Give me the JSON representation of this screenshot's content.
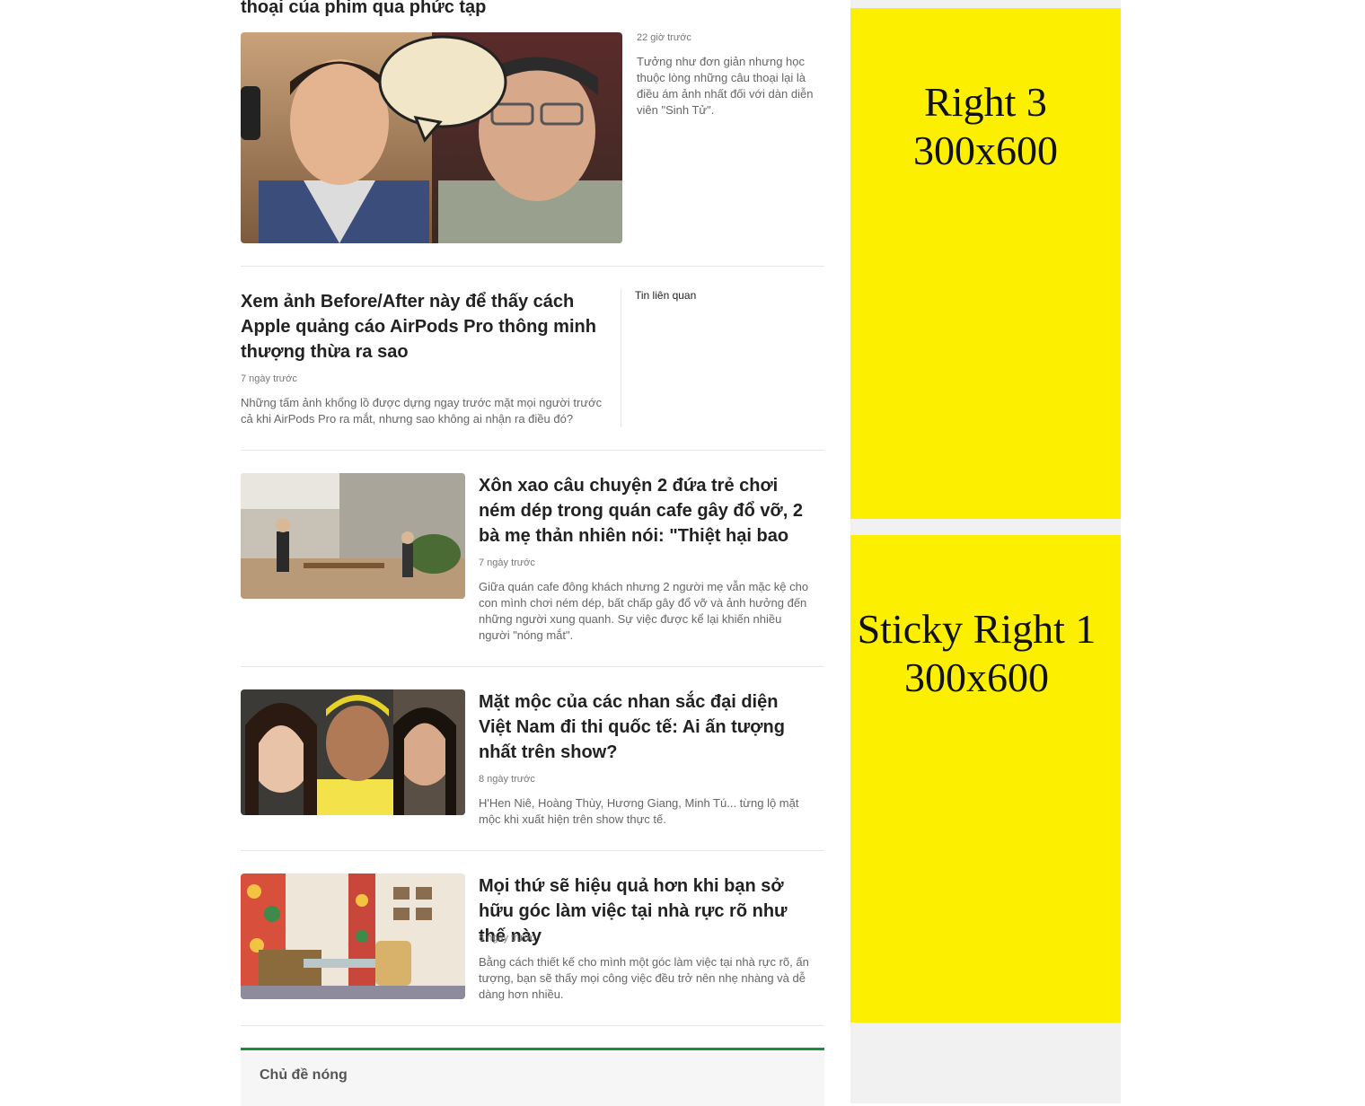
{
  "top_article": {
    "title_partial": "thoại của phim qua phức tạp",
    "time": "22 giờ trước",
    "description": "Tưởng như đơn giản nhưng học thuộc lòng những câu thoại lại là điều ám ảnh nhất đối với dàn diễn viên \"Sinh Tử\"."
  },
  "article_2": {
    "title": "Xem ảnh Before/After này để thấy cách Apple quảng cáo AirPods Pro thông minh thượng thừa ra sao",
    "time": "7 ngày trước",
    "description": "Những tấm ảnh khổng lồ được dựng ngay trước mặt mọi người trước cả khi AirPods Pro ra mắt, nhưng sao không ai nhận ra điều đó?",
    "related_label": "Tin liên quan"
  },
  "articles": [
    {
      "title": "Xôn xao câu chuyện 2 đứa trẻ chơi ném dép trong quán cafe gây đổ vỡ, 2 bà mẹ thản nhiên nói: \"Thiệt hại bao",
      "time": "7 ngày trước",
      "description": "Giữa quán cafe đông khách nhưng 2 người mẹ vẫn mặc kệ cho con mình chơi ném dép, bất chấp gây đổ vỡ và ảnh hưởng đến những người xung quanh. Sự việc được kể lại khiến nhiều người \"nóng mắt\"."
    },
    {
      "title": "Mặt mộc của các nhan sắc đại diện Việt Nam đi thi quốc tế: Ai ấn tượng nhất trên show?",
      "time": "8 ngày trước",
      "description": "H'Hen Niê, Hoàng Thùy, Hương Giang, Minh Tú... từng lộ mặt mộc khi xuất hiện trên show thực tế."
    },
    {
      "title": "Mọi thứ sẽ hiệu quả hơn khi bạn sở hữu góc làm việc tại nhà rực rõ như thế này",
      "time": "8 ngày trước",
      "description": "Bằng cách thiết kế cho mình một góc làm việc tại nhà rực rõ, ấn tượng, bạn sẽ thấy mọi công việc đều trở nên nhẹ nhàng và dễ dàng hơn nhiều."
    }
  ],
  "hot_topics": {
    "title": "Chủ đề nóng"
  },
  "ads": {
    "right3": {
      "line1": "Right 3",
      "line2": "300x600"
    },
    "sticky1": {
      "line1": "Sticky Right 1",
      "line2": "300x600"
    }
  },
  "colors": {
    "accent": "#1a8e3b",
    "ad_bg": "#fcf000"
  }
}
